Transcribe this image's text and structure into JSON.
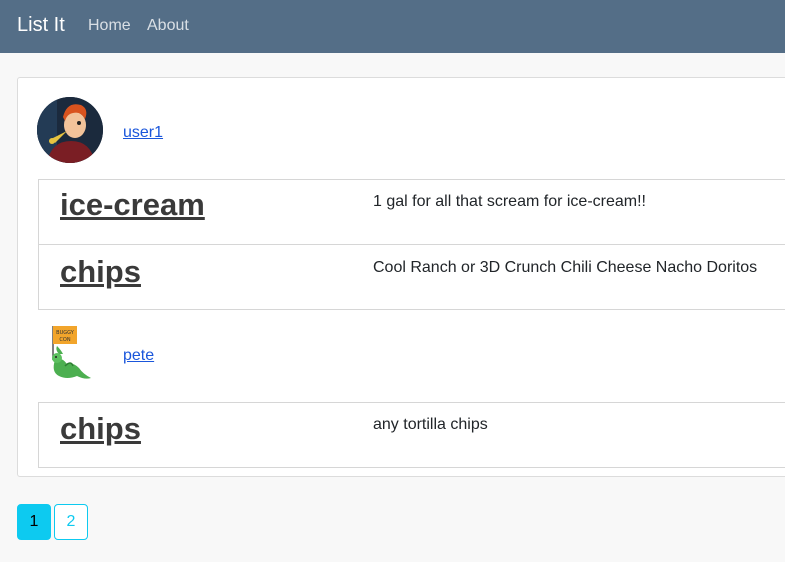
{
  "navbar": {
    "brand": "List It",
    "links": [
      "Home",
      "About"
    ]
  },
  "groups": [
    {
      "user": "user1",
      "avatar_icon": "avatar-photo",
      "items": [
        {
          "title": "ice-cream",
          "description": "1 gal for all that scream for ice-cream!!"
        },
        {
          "title": "chips",
          "description": "Cool Ranch or 3D Crunch Chili Cheese Nacho Doritos"
        }
      ]
    },
    {
      "user": "pete",
      "avatar_icon": "dragon-flag-icon",
      "avatar_text": [
        "BUGGY",
        "CON"
      ],
      "items": [
        {
          "title": "chips",
          "description": "any tortilla chips"
        }
      ]
    }
  ],
  "pagination": {
    "pages": [
      "1",
      "2"
    ],
    "active": "1"
  },
  "colors": {
    "navbar": "#546e87",
    "accent": "#0dcaf0",
    "link": "#1a56db",
    "title": "#3a3a3a"
  }
}
